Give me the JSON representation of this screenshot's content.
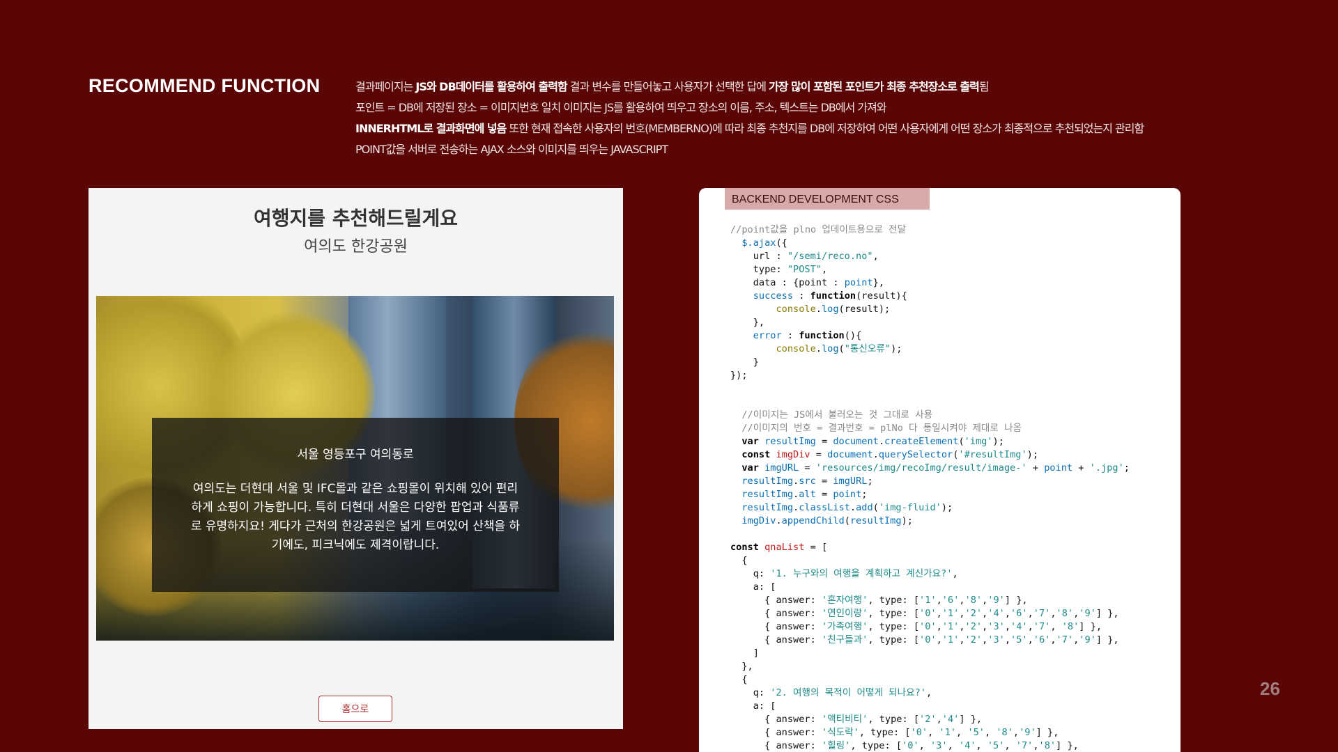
{
  "heading": "RECOMMEND FUNCTION",
  "description": {
    "line1": [
      {
        "text": "결과페이지는 ",
        "bold": false
      },
      {
        "text": "JS와 DB데이터를 활용하여 출력함",
        "bold": true
      },
      {
        "text": " 결과 변수를 만들어놓고 사용자가 선택한 답에 ",
        "bold": false
      },
      {
        "text": "가장 많이 포함된 포인트가 최종 추천장소로 출력",
        "bold": true
      },
      {
        "text": "됨",
        "bold": false
      }
    ],
    "line2": "포인트 = DB에 저장된 장소 = 이미지번호 일치 이미지는 JS를 활용하여 띄우고 장소의 이름, 주소, 텍스트는 DB에서 가져와",
    "line3": [
      {
        "text": "INNERHTML로 결과화면에 넣음",
        "bold": true
      },
      {
        "text": " 또한 현재 접속한 사용자의 번호(MEMBERNO)에 따라 최종 추천지를 DB에 저장하여 어떤 사용자에게 어떤 장소가 최종적으로 추천되었는지 관리함",
        "bold": false
      }
    ],
    "line4": "POINT값을 서버로 전송하는 AJAX 소스와 이미지를 띄우는 JAVASCRIPT"
  },
  "result_page": {
    "title": "여행지를 추천해드릴게요",
    "place_name": "여의도 한강공원",
    "address": "서울 영등포구 여의동로",
    "text_lines": [
      "여의도는 더현대 서울 및 IFC몰과 같은 쇼핑몰이 위치해 있어 편리",
      "하게 쇼핑이 가능합니다. 특히 더현대 서울은 다양한 팝업과 식품류",
      "로 유명하지요! 게다가 근처의 한강공원은 넓게 트여있어 산책을 하",
      "기에도, 피크닉에도 제격이랍니다."
    ],
    "home_button": "홈으로"
  },
  "code_panel": {
    "tab_label": "BACKEND DEVELOPMENT  CSS"
  },
  "page_number": "26",
  "colors": {
    "background": "#5a0606",
    "accent": "#b12b2b",
    "tab": "#d9a8a8"
  }
}
